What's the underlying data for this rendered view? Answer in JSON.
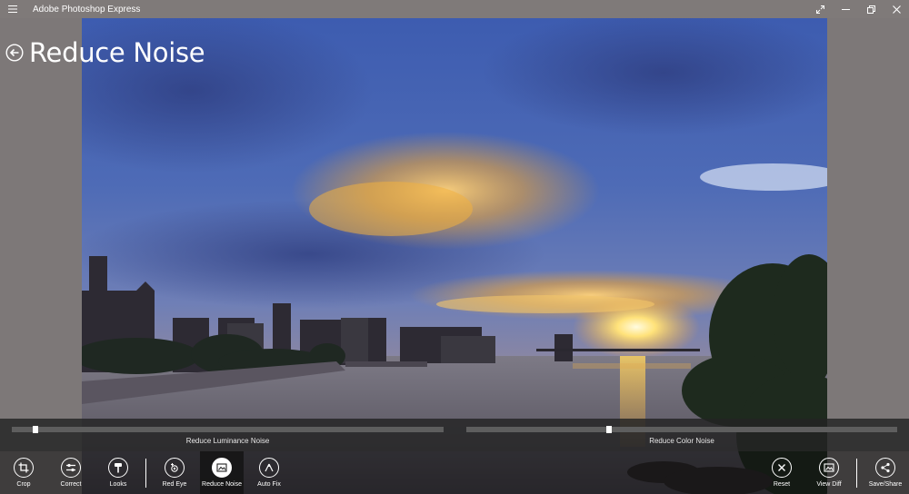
{
  "window": {
    "title": "Adobe Photoshop Express",
    "menu_icon": "hamburger-icon",
    "controls": [
      "fullscreen-icon",
      "minimize-icon",
      "restore-icon",
      "close-icon"
    ]
  },
  "page": {
    "title": "Reduce Noise",
    "back_icon": "back-arrow-icon"
  },
  "sliders": [
    {
      "label": "Reduce Luminance Noise",
      "value": 0.05
    },
    {
      "label": "Reduce Color Noise",
      "value": 0.33
    }
  ],
  "toolbar": {
    "left": [
      {
        "label": "Crop",
        "icon": "crop-icon"
      },
      {
        "label": "Correct",
        "icon": "sliders-icon"
      },
      {
        "label": "Looks",
        "icon": "paint-roller-icon"
      },
      {
        "label": "Red Eye",
        "icon": "red-eye-icon"
      },
      {
        "label": "Reduce Noise",
        "icon": "reduce-noise-icon",
        "active": true
      },
      {
        "label": "Auto Fix",
        "icon": "magic-wand-icon"
      }
    ],
    "right": [
      {
        "label": "Reset",
        "icon": "reset-icon"
      },
      {
        "label": "View Diff",
        "icon": "view-diff-icon"
      },
      {
        "label": "Save/Share",
        "icon": "share-icon"
      }
    ]
  },
  "colors": {
    "chrome": "#7f7a79",
    "panel": "#232323",
    "text": "#ffffff",
    "sky_top": "#3a55a8",
    "sunset_gold": "#e8a33a"
  }
}
